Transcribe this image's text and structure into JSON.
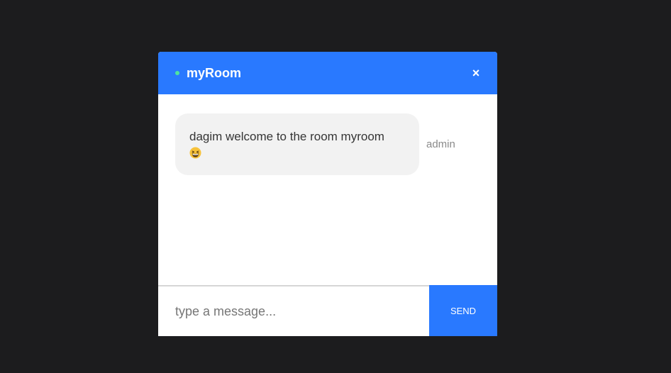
{
  "header": {
    "room_name": "myRoom",
    "close_glyph": "×",
    "status_color": "#4fe3a0",
    "accent_color": "#2979ff"
  },
  "messages": [
    {
      "text": "dagim welcome to the room myroom",
      "emoji": "grinning-squinting-face",
      "sender": "admin"
    }
  ],
  "composer": {
    "placeholder": "type a message...",
    "value": "",
    "send_label": "SEND"
  }
}
